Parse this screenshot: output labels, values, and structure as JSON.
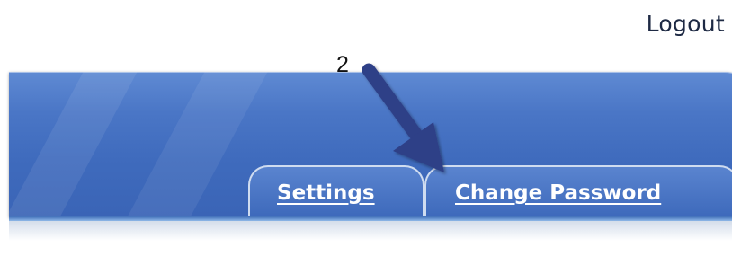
{
  "header": {
    "logout_label": "Logout"
  },
  "tabs": [
    {
      "label": "Settings"
    },
    {
      "label": "Change Password"
    }
  ],
  "callout": {
    "number": "2"
  },
  "colors": {
    "header_blue": "#4a76c6",
    "tab_border": "#cfdcf0",
    "arrow": "#2f3f87",
    "text_dark": "#1e2a44"
  }
}
